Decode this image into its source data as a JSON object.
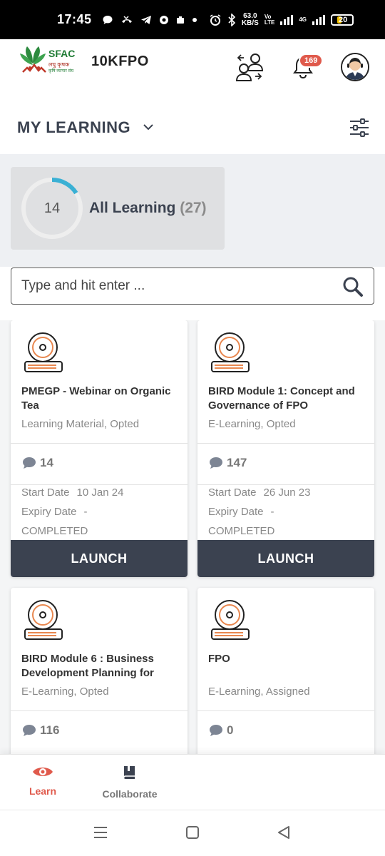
{
  "status_bar": {
    "time": "17:45",
    "net_speed_value": "63.0",
    "net_speed_unit": "KB/S",
    "volte_top": "Vo",
    "volte_mid": "LTE",
    "volte_bot": "",
    "network": "4G",
    "battery": "20"
  },
  "header": {
    "logo_text": "SFAC",
    "logo_hindi": "लघु कृषक",
    "logo_hindi2": "कृषि व्यापार संघ",
    "brand": "10KFPO",
    "notification_count": "169"
  },
  "page": {
    "title": "MY LEARNING"
  },
  "summary": {
    "ring_value": "14",
    "ring_progress": 0.16,
    "label": "All Learning",
    "count": "(27)"
  },
  "search": {
    "placeholder": "Type and hit enter ..."
  },
  "labels": {
    "start_date": "Start Date",
    "expiry_date": "Expiry Date",
    "launch": "LAUNCH"
  },
  "cards": [
    {
      "title": "PMEGP - Webinar on Organic Tea",
      "meta": "Learning Material, Opted",
      "comments": "14",
      "start_date": "10 Jan 24",
      "expiry_date": "-",
      "status": "COMPLETED"
    },
    {
      "title": "BIRD Module 1: Concept and Governance of FPO",
      "meta": "E-Learning, Opted",
      "comments": "147",
      "start_date": "26 Jun 23",
      "expiry_date": "-",
      "status": "COMPLETED"
    },
    {
      "title": "BIRD Module 6 : Business Development Planning for",
      "meta": "E-Learning, Opted",
      "comments": "116"
    },
    {
      "title": "FPO",
      "meta": "E-Learning, Assigned",
      "comments": "0"
    }
  ],
  "bottom_nav": {
    "learn": "Learn",
    "collaborate": "Collaborate"
  },
  "colors": {
    "accent": "#e05a4c",
    "dark": "#3b4250",
    "ring": "#3ab0d4"
  }
}
